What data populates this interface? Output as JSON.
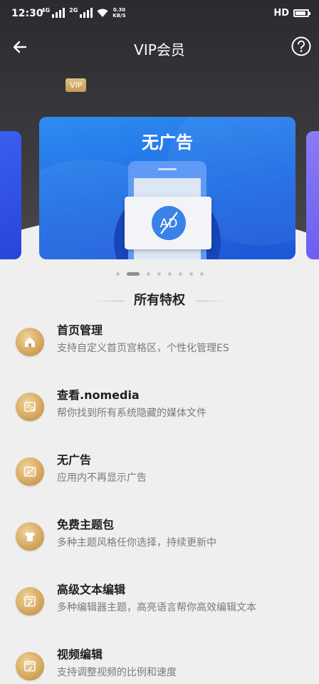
{
  "status_bar": {
    "time": "12:30",
    "signal_tag_1": "4G",
    "signal_tag_2": "2G",
    "net_speed_value": "0.30",
    "net_speed_unit": "KB/S",
    "hd_label": "HD",
    "battery_level": 0.78
  },
  "app_bar": {
    "title": "VIP会员"
  },
  "vip_badge": "VIP",
  "carousel": {
    "active_index": 1,
    "total": 8,
    "current_card": {
      "title": "无广告",
      "ad_label": "AD"
    }
  },
  "section": {
    "title": "所有特权"
  },
  "features": [
    {
      "title": "首页管理",
      "desc": "支持自定义首页宫格区，个性化管理ES",
      "icon": "home-icon"
    },
    {
      "title": "查看.nomedia",
      "desc": "帮你找到所有系统隐藏的媒体文件",
      "icon": "nomedia-icon"
    },
    {
      "title": "无广告",
      "desc": "应用内不再显示广告",
      "icon": "ad-icon"
    },
    {
      "title": "免费主题包",
      "desc": "多种主题风格任你选择，持续更新中",
      "icon": "tshirt-icon"
    },
    {
      "title": "高级文本编辑",
      "desc": "多种编辑器主题，高亮语言帮你高效编辑文本",
      "icon": "text-edit-icon"
    },
    {
      "title": "视频编辑",
      "desc": "支持调整视频的比例和速度",
      "icon": "video-edit-icon"
    }
  ],
  "colors": {
    "header_dark": "#2b2b2f",
    "card_blue": "#1f6fe5",
    "gold": "#d6aa62",
    "background": "#efefef"
  }
}
